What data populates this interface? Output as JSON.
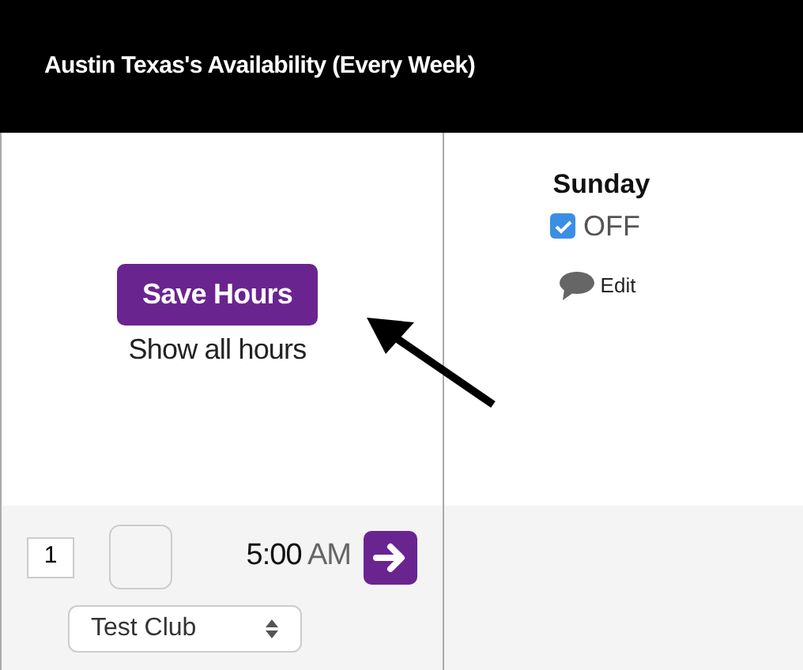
{
  "header": {
    "title": "Austin Texas's Availability (Every Week)"
  },
  "sidebar": {
    "save_button": "Save Hours",
    "show_all_link": "Show all hours"
  },
  "day": {
    "name": "Sunday",
    "off_label": "OFF",
    "off_checked": true,
    "edit_label": "Edit"
  },
  "slot": {
    "number": "1",
    "selected": false,
    "time": "5:00",
    "period": "AM",
    "club": "Test Club"
  }
}
